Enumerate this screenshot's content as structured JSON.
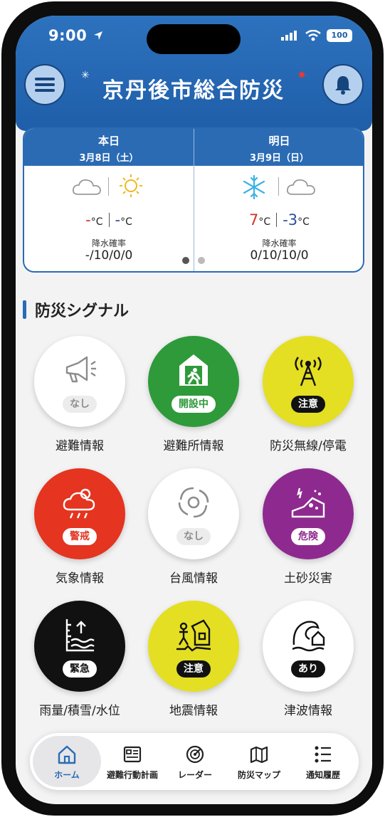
{
  "status": {
    "time": "9:00",
    "battery": "100"
  },
  "header": {
    "title": "京丹後市総合防災"
  },
  "weather": {
    "today": {
      "label": "本日",
      "date": "3月8日（土）",
      "high": "-",
      "low": "-",
      "unit": "°C",
      "precip_label": "降水確率",
      "precip": "-/10/0/0"
    },
    "tomorrow": {
      "label": "明日",
      "date": "3月9日（日）",
      "high": "7",
      "low": "-3",
      "unit": "°C",
      "precip_label": "降水確率",
      "precip": "0/10/10/0"
    }
  },
  "section": {
    "title": "防災シグナル"
  },
  "signals": [
    {
      "label": "避難情報",
      "badge": "なし",
      "icon": "megaphone-icon"
    },
    {
      "label": "避難所情報",
      "badge": "開設中",
      "icon": "shelter-exit-icon"
    },
    {
      "label": "防災無線/停電",
      "badge": "注意",
      "icon": "radio-tower-icon"
    },
    {
      "label": "気象情報",
      "badge": "警戒",
      "icon": "storm-cloud-icon"
    },
    {
      "label": "台風情報",
      "badge": "なし",
      "icon": "typhoon-icon"
    },
    {
      "label": "土砂災害",
      "badge": "危険",
      "icon": "landslide-icon"
    },
    {
      "label": "雨量/積雪/水位",
      "badge": "緊急",
      "icon": "water-level-icon"
    },
    {
      "label": "地震情報",
      "badge": "注意",
      "icon": "earthquake-icon"
    },
    {
      "label": "津波情報",
      "badge": "あり",
      "icon": "tsunami-icon"
    }
  ],
  "nav": [
    {
      "label": "ホーム",
      "icon": "home-icon"
    },
    {
      "label": "避難行動計画",
      "icon": "plan-icon"
    },
    {
      "label": "レーダー",
      "icon": "radar-icon"
    },
    {
      "label": "防災マップ",
      "icon": "map-icon"
    },
    {
      "label": "通知履歴",
      "icon": "list-icon"
    }
  ],
  "colors": {
    "header": "#2a6bb4",
    "green": "#2e9a3a",
    "yellow": "#e4df22",
    "red": "#e5341f",
    "purple": "#8e2a8f",
    "black": "#111111",
    "temp_high": "#d0342c",
    "temp_low": "#2a4fa0"
  }
}
